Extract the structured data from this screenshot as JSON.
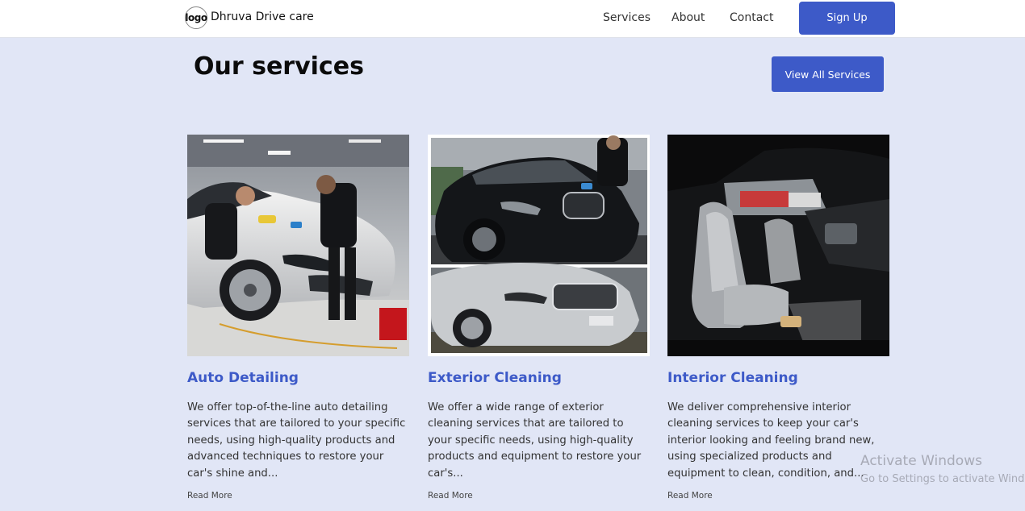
{
  "nav": {
    "logo_text": "logo",
    "brand": "Dhruva Drive care",
    "links": [
      "Services",
      "About",
      "Contact"
    ],
    "signup_label": "Sign Up"
  },
  "header": {
    "title": "Our services",
    "view_all_label": "View All Services"
  },
  "cards": [
    {
      "image_icon": "car-detailing-photo",
      "title": "Auto Detailing",
      "description": "We offer top-of-the-line auto detailing services that are tailored to your specific needs, using high-quality products and advanced techniques to restore your car's shine and...",
      "link_label": "Read More"
    },
    {
      "image_icon": "exterior-cleaning-photo",
      "title": "Exterior Cleaning",
      "description": "We offer a wide range of exterior cleaning services that are tailored to your specific needs, using high-quality products and equipment to restore your car's...",
      "link_label": "Read More"
    },
    {
      "image_icon": "interior-cleaning-photo",
      "title": "Interior Cleaning",
      "description": "We deliver comprehensive interior cleaning services to keep your car's interior looking and feeling brand new, using specialized products and equipment to clean, condition, and...",
      "link_label": "Read More"
    }
  ],
  "watermark": {
    "line1": "Activate Windows",
    "line2": "Go to Settings to activate Windows."
  },
  "colors": {
    "accent": "#3d5ac8",
    "background": "#e1e6f6"
  }
}
